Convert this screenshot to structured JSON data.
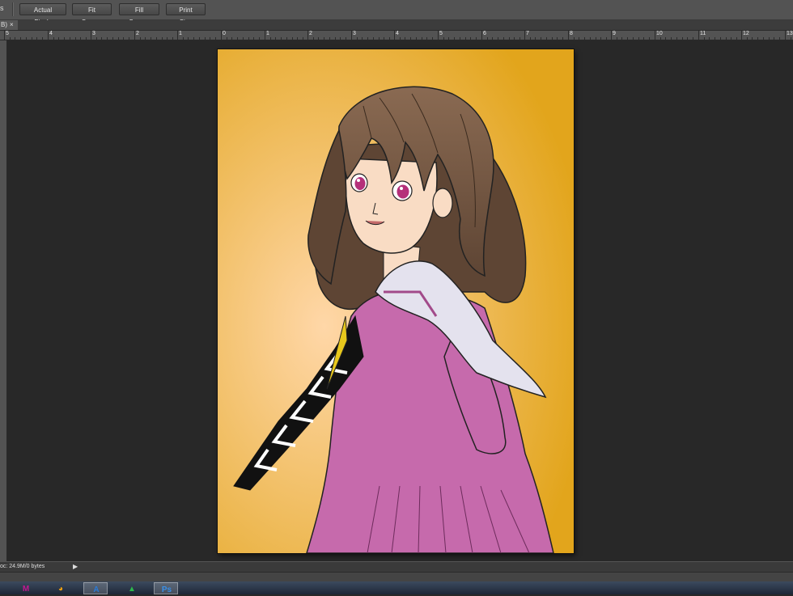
{
  "options_bar": {
    "edge_label": "s",
    "buttons": [
      "Actual Pixels",
      "Fit Screen",
      "Fill Screen",
      "Print Size"
    ]
  },
  "document_tab": {
    "name": "B)",
    "close_glyph": "×"
  },
  "ruler": {
    "labels": [
      "5",
      "4",
      "3",
      "2",
      "1",
      "0",
      "1",
      "2",
      "3",
      "4",
      "5",
      "6",
      "7",
      "8",
      "9",
      "10",
      "11",
      "12",
      "13"
    ]
  },
  "status_bar": {
    "doc_size": "oc: 24.9M/0 bytes",
    "menu_arrow": "▶"
  },
  "taskbar": {
    "apps": [
      {
        "name": "m-app-icon",
        "glyph": "M",
        "color": "#c01890"
      },
      {
        "name": "chrome-icon",
        "glyph": "◕",
        "color": "#f0a010"
      },
      {
        "name": "a-app-icon",
        "glyph": "A",
        "color": "#2a7ad8"
      },
      {
        "name": "green-app-icon",
        "glyph": "▲",
        "color": "#2cb84c"
      },
      {
        "name": "photoshop-icon",
        "glyph": "Ps",
        "color": "#3a8fe8"
      }
    ]
  },
  "artwork": {
    "subject": "anime-girl-illustration",
    "colors": {
      "background_outer": "#e2a51c",
      "background_glow": "#ffd7a8",
      "hair": "#5e4534",
      "uniform": "#c66aac",
      "collar": "#e4e2ee",
      "skin": "#f9dcc4",
      "eyes": "#b5307a"
    }
  },
  "colors": {
    "workspace": "#282828",
    "panel": "#535353"
  }
}
